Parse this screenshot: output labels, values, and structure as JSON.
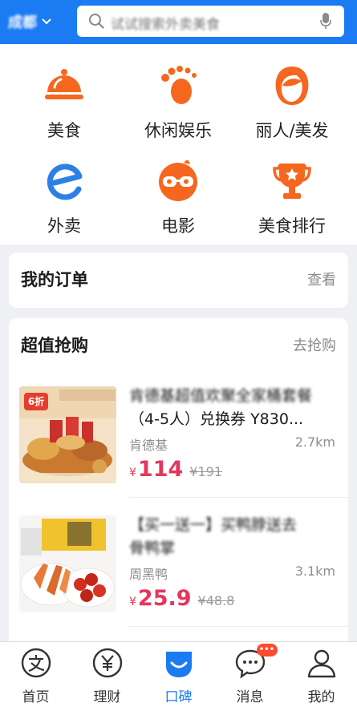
{
  "header": {
    "city": "成都",
    "search_placeholder": "试试搜索外卖美食"
  },
  "categories": [
    {
      "label": "美食",
      "icon": "food-cloche-icon"
    },
    {
      "label": "休闲娱乐",
      "icon": "footprint-icon"
    },
    {
      "label": "丽人/美发",
      "icon": "beauty-face-icon"
    },
    {
      "label": "外卖",
      "icon": "takeout-e-icon"
    },
    {
      "label": "电影",
      "icon": "movie-glasses-icon"
    },
    {
      "label": "美食排行",
      "icon": "trophy-icon"
    }
  ],
  "orders": {
    "title": "我的订单",
    "action": "查看"
  },
  "deals_section": {
    "title": "超值抢购",
    "action": "去抢购",
    "items": [
      {
        "name_line1": "肯德基超值欢聚全家桶套餐",
        "name_line2": "（4-5人）兑换券 Y830...",
        "shop": "肯德基",
        "distance": "2.7km",
        "currency": "¥",
        "price": "114",
        "original_price": "¥191",
        "thumb_badge": "6折"
      },
      {
        "name_line1": "【买一送一】买鸭脖送去",
        "name_line2": "骨鸭掌",
        "shop": "周黑鸭",
        "distance": "3.1km",
        "currency": "¥",
        "price": "25.9",
        "original_price": "¥48.8"
      }
    ]
  },
  "tabbar": {
    "tabs": [
      {
        "label": "首页",
        "icon": "alipay-home-icon"
      },
      {
        "label": "理财",
        "icon": "yuan-coin-icon"
      },
      {
        "label": "口碑",
        "icon": "koubei-smile-icon"
      },
      {
        "label": "消息",
        "icon": "chat-bubble-icon",
        "badge": "•••"
      },
      {
        "label": "我的",
        "icon": "person-icon"
      }
    ]
  },
  "colors": {
    "brand_blue": "#1b7bf2",
    "price_red": "#e5365b",
    "icon_orange": "#f5671f"
  }
}
